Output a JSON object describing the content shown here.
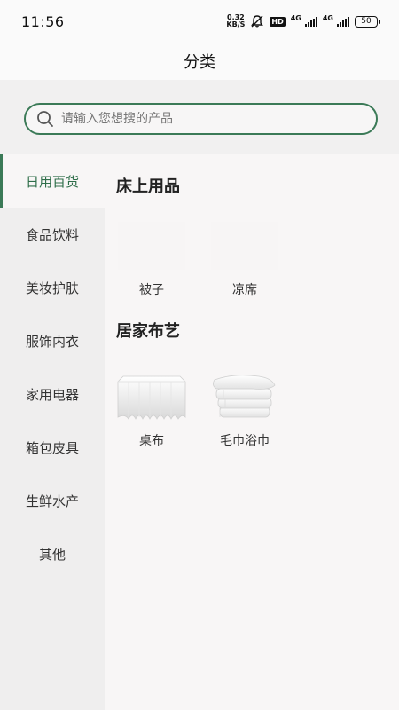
{
  "status_bar": {
    "time": "11:56",
    "net_speed_value": "0.32",
    "net_speed_unit": "KB/S",
    "hd_label": "HD",
    "net_type_1": "4G",
    "net_type_2": "4G",
    "battery": "50"
  },
  "header": {
    "title": "分类"
  },
  "search": {
    "placeholder": "请输入您想搜的产品"
  },
  "sidebar": {
    "active_index": 0,
    "items": [
      {
        "label": "日用百货"
      },
      {
        "label": "食品饮料"
      },
      {
        "label": "美妆护肤"
      },
      {
        "label": "服饰内衣"
      },
      {
        "label": "家用电器"
      },
      {
        "label": "箱包皮具"
      },
      {
        "label": "生鲜水产"
      },
      {
        "label": "其他"
      }
    ]
  },
  "content": {
    "sections": [
      {
        "title": "床上用品",
        "products": [
          {
            "name": "被子",
            "icon": "quilt-image"
          },
          {
            "name": "凉席",
            "icon": "summer-mat-image"
          }
        ]
      },
      {
        "title": "居家布艺",
        "products": [
          {
            "name": "桌布",
            "icon": "tablecloth-image"
          },
          {
            "name": "毛巾浴巾",
            "icon": "towels-image"
          }
        ]
      }
    ]
  },
  "colors": {
    "accent": "#3b7a57",
    "sidebar_bg": "#efeeee",
    "content_bg": "#f8f6f6"
  }
}
